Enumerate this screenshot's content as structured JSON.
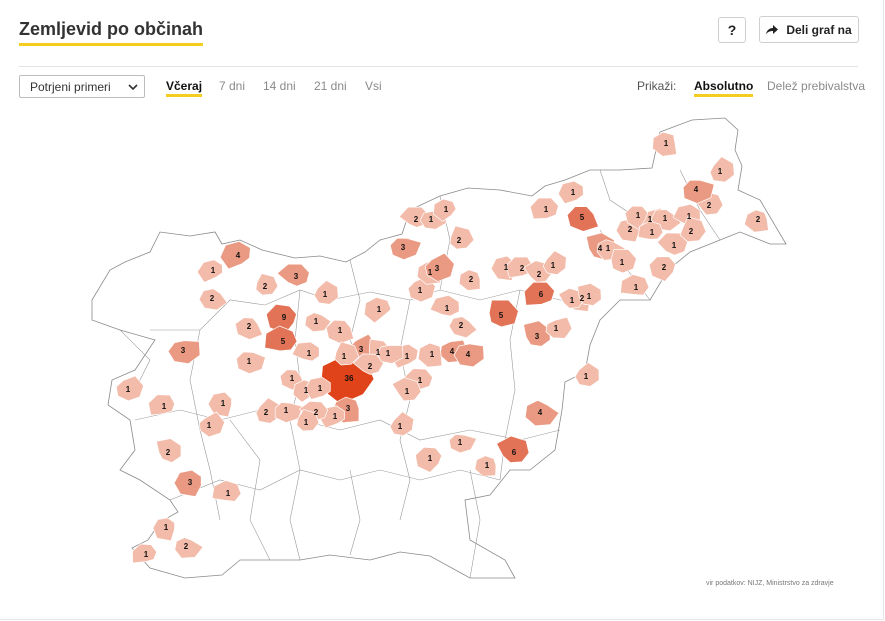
{
  "title": "Zemljevid po občinah",
  "help_label": "?",
  "share_label": "Deli graf na",
  "filter": {
    "selected": "Potrjeni primeri"
  },
  "periods": [
    "Včeraj",
    "7 dni",
    "14 dni",
    "21 dni",
    "Vsi"
  ],
  "active_period": "Včeraj",
  "display": {
    "label": "Prikaži:",
    "options": [
      "Absolutno",
      "Delež prebivalstva"
    ],
    "active": "Absolutno"
  },
  "source": "vir podatkov: NIJZ, Ministrstvo za zdravje",
  "colors": {
    "accent": "#f5cd1f",
    "low": "#f3bba9",
    "mid": "#ea9a82",
    "high": "#e27357",
    "max": "#e04319",
    "border": "#8a8a8a"
  },
  "map_values": [
    "1",
    "4",
    "2",
    "2",
    "1",
    "5",
    "1",
    "1",
    "1",
    "2",
    "1",
    "4",
    "2",
    "1",
    "3",
    "2",
    "1",
    "1",
    "1",
    "1",
    "2",
    "2",
    "1",
    "3",
    "2",
    "2",
    "2",
    "1",
    "4",
    "3",
    "1",
    "2",
    "6",
    "1",
    "1",
    "1",
    "1",
    "1",
    "9",
    "5",
    "3",
    "3",
    "1",
    "2",
    "1",
    "1",
    "1",
    "5",
    "1",
    "2",
    "1",
    "1",
    "1",
    "1",
    "2",
    "3",
    "2",
    "36",
    "1",
    "1",
    "4",
    "4",
    "1",
    "1",
    "1",
    "2",
    "1",
    "1",
    "1",
    "1",
    "1",
    "1",
    "1",
    "2",
    "1",
    "3",
    "1",
    "2",
    "1",
    "1",
    "1",
    "4",
    "1",
    "1",
    "6",
    "1",
    "1",
    "1",
    "3",
    "1",
    "1",
    "2",
    "1",
    "2",
    "1",
    "1"
  ]
}
